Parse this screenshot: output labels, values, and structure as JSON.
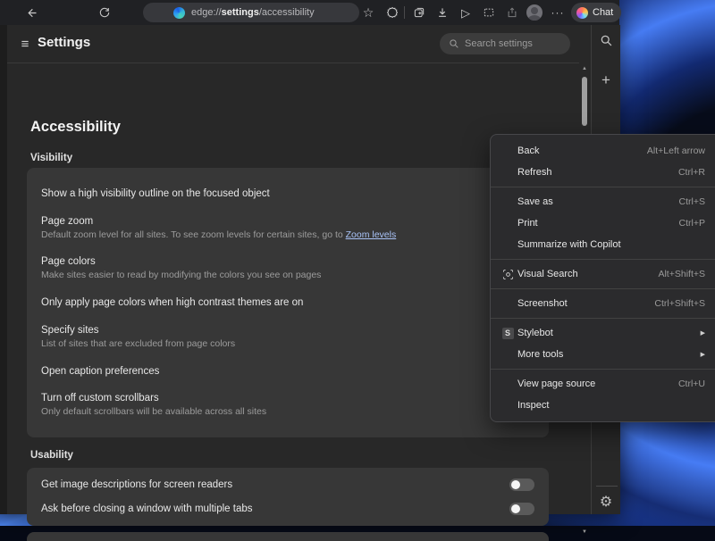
{
  "browser": {
    "url_scheme": "edge://",
    "url_host": "settings",
    "url_path": "/accessibility",
    "chat_label": "Chat"
  },
  "settings": {
    "title": "Settings",
    "search_placeholder": "Search settings",
    "page_title": "Accessibility",
    "sections": [
      {
        "heading": "Visibility",
        "rows": [
          {
            "title": "Show a high visibility outline on the focused object"
          },
          {
            "title": "Page zoom",
            "description": "Default zoom level for all sites. To see zoom levels for certain sites, go to ",
            "link": "Zoom levels"
          },
          {
            "title": "Page colors",
            "description": "Make sites easier to read by modifying the colors you see on pages"
          },
          {
            "title": "Only apply page colors when high contrast themes are on"
          },
          {
            "title": "Specify sites",
            "description": "List of sites that are excluded from page colors"
          },
          {
            "title": "Open caption preferences"
          },
          {
            "title": "Turn off custom scrollbars",
            "description": "Only default scrollbars will be available across all sites"
          }
        ]
      },
      {
        "heading": "Usability",
        "rows": [
          {
            "title": "Get image descriptions for screen readers",
            "toggle": "off"
          },
          {
            "title": "Ask before closing a window with multiple tabs",
            "toggle": "off"
          }
        ]
      }
    ]
  },
  "context_menu": {
    "items": [
      {
        "label": "Back",
        "shortcut": "Alt+Left arrow"
      },
      {
        "label": "Refresh",
        "shortcut": "Ctrl+R"
      },
      {
        "label": "Save as",
        "shortcut": "Ctrl+S"
      },
      {
        "label": "Print",
        "shortcut": "Ctrl+P"
      },
      {
        "label": "Summarize with Copilot"
      },
      {
        "label": "Visual Search",
        "shortcut": "Alt+Shift+S",
        "icon": "visual-search"
      },
      {
        "label": "Screenshot",
        "shortcut": "Ctrl+Shift+S"
      },
      {
        "label": "Stylebot",
        "icon": "stylebot-s",
        "submenu": true
      },
      {
        "label": "More tools",
        "submenu": true
      },
      {
        "label": "View page source",
        "shortcut": "Ctrl+U"
      },
      {
        "label": "Inspect"
      }
    ],
    "stylebot_badge": "S"
  },
  "icons": {
    "toolbar": [
      "back-icon",
      "refresh-icon",
      "favorites-star-icon",
      "extensions-icon",
      "collections-icon",
      "download-icon",
      "send-icon",
      "web-capture-icon",
      "share-icon",
      "avatar",
      "more-menu-icon",
      "copilot-chat-icon"
    ],
    "rail": [
      "search-icon",
      "plus-icon",
      "gear-icon"
    ],
    "scrollbar": [
      "scroll-up-icon",
      "scroll-down-icon"
    ]
  },
  "colors": {
    "link": "#a9c3f7",
    "card_bg": "#373737",
    "menu_bg": "#2b2b2d",
    "toggle_track": "#5a5a5a",
    "wallpaper_blue": "#4a82ff",
    "toolbar_bg": "#202124"
  }
}
